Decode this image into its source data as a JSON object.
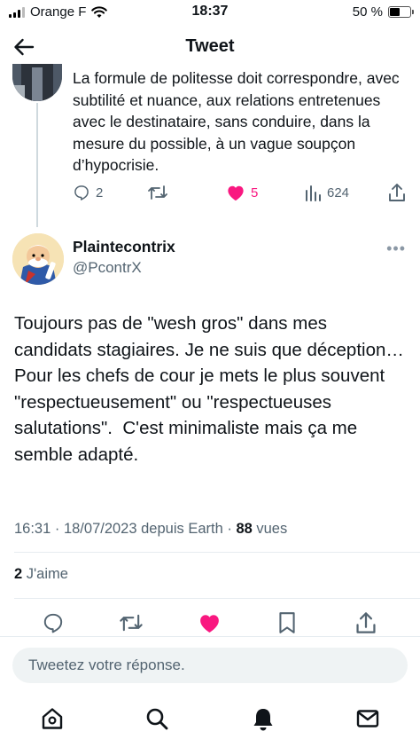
{
  "status_bar": {
    "carrier": "Orange F",
    "time": "18:37",
    "battery_text": "50 %",
    "battery_level": 0.5
  },
  "header": {
    "title": "Tweet",
    "back_icon": "arrow-left-icon"
  },
  "parent_tweet": {
    "text": "La formule de politesse doit correspondre, avec subtilité et nuance, aux relations entretenues avec le destinataire, sans conduire, dans la mesure du possible, à un vague soupçon d’hypocrisie.",
    "replies": "2",
    "likes": "5",
    "views": "624",
    "icons": [
      "reply-icon",
      "retweet-icon",
      "heart-filled-icon",
      "views-chart-icon",
      "share-icon"
    ],
    "like_color": "#f91880"
  },
  "tweet": {
    "author_name": "Plaintecontrix",
    "author_handle": "@PcontrX",
    "more_label": "•••",
    "text": "Toujours pas de \"wesh gros\" dans mes candidats stagiaires. Je ne suis que déception…\nPour les chefs de cour je mets le plus souvent \"respectueusement\" ou \"respectueuses salutations\".  C'est minimaliste mais ça me semble adapté.",
    "timestamp": "16:31 · 18/07/2023 depuis Earth · ",
    "views_count": "88",
    "views_label": " vues",
    "likes_count": "2",
    "likes_label": " J'aime",
    "action_icons": [
      "reply-icon",
      "retweet-icon",
      "heart-filled-icon",
      "bookmark-icon",
      "share-icon"
    ]
  },
  "reply": {
    "placeholder": "Tweetez votre réponse."
  },
  "bottom_nav": {
    "items": [
      "home-icon",
      "search-icon",
      "notifications-bell-icon",
      "messages-mail-icon"
    ]
  },
  "colors": {
    "text": "#0f1419",
    "secondary": "#536471",
    "like": "#f91880",
    "input_bg": "#eff3f4"
  }
}
